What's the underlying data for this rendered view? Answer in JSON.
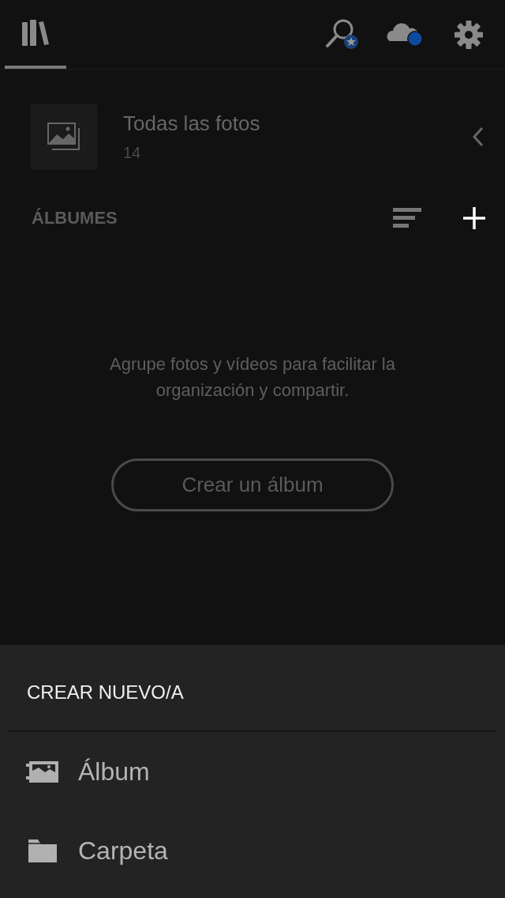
{
  "top_bar": {
    "tabs": [
      {
        "kind": "library",
        "selected": true
      }
    ]
  },
  "all_photos": {
    "title": "Todas las fotos",
    "count": "14"
  },
  "albums": {
    "heading": "ÁLBUMES",
    "empty_message": "Agrupe fotos y vídeos para facilitar la organización y compartir.",
    "create_button": "Crear un álbum"
  },
  "create_sheet": {
    "title": "CREAR NUEVO/A",
    "items": [
      {
        "kind": "album",
        "label": "Álbum"
      },
      {
        "kind": "folder",
        "label": "Carpeta"
      }
    ]
  }
}
